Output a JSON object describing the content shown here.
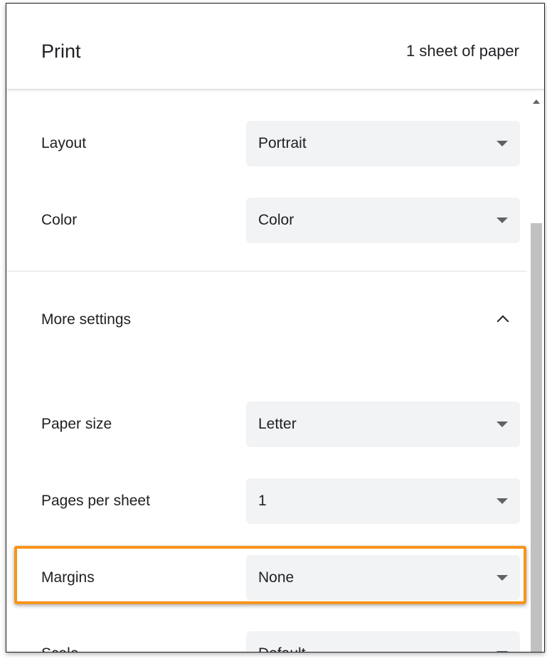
{
  "dialog": {
    "title": "Print",
    "sheet_count": "1 sheet of paper"
  },
  "settings": [
    {
      "label": "Layout",
      "value": "Portrait"
    },
    {
      "label": "Color",
      "value": "Color"
    }
  ],
  "more_settings": {
    "label": "More settings",
    "expanded": true
  },
  "advanced": [
    {
      "label": "Paper size",
      "value": "Letter"
    },
    {
      "label": "Pages per sheet",
      "value": "1"
    },
    {
      "label": "Margins",
      "value": "None",
      "highlighted": true
    },
    {
      "label": "Scale",
      "value": "Default"
    }
  ],
  "colors": {
    "highlight": "#f7941d",
    "select_bg": "#f1f3f4"
  },
  "icons": {
    "dropdown": "caret-down-icon",
    "collapse": "chevron-up-icon",
    "scroll_up": "scroll-up-arrow-icon"
  }
}
